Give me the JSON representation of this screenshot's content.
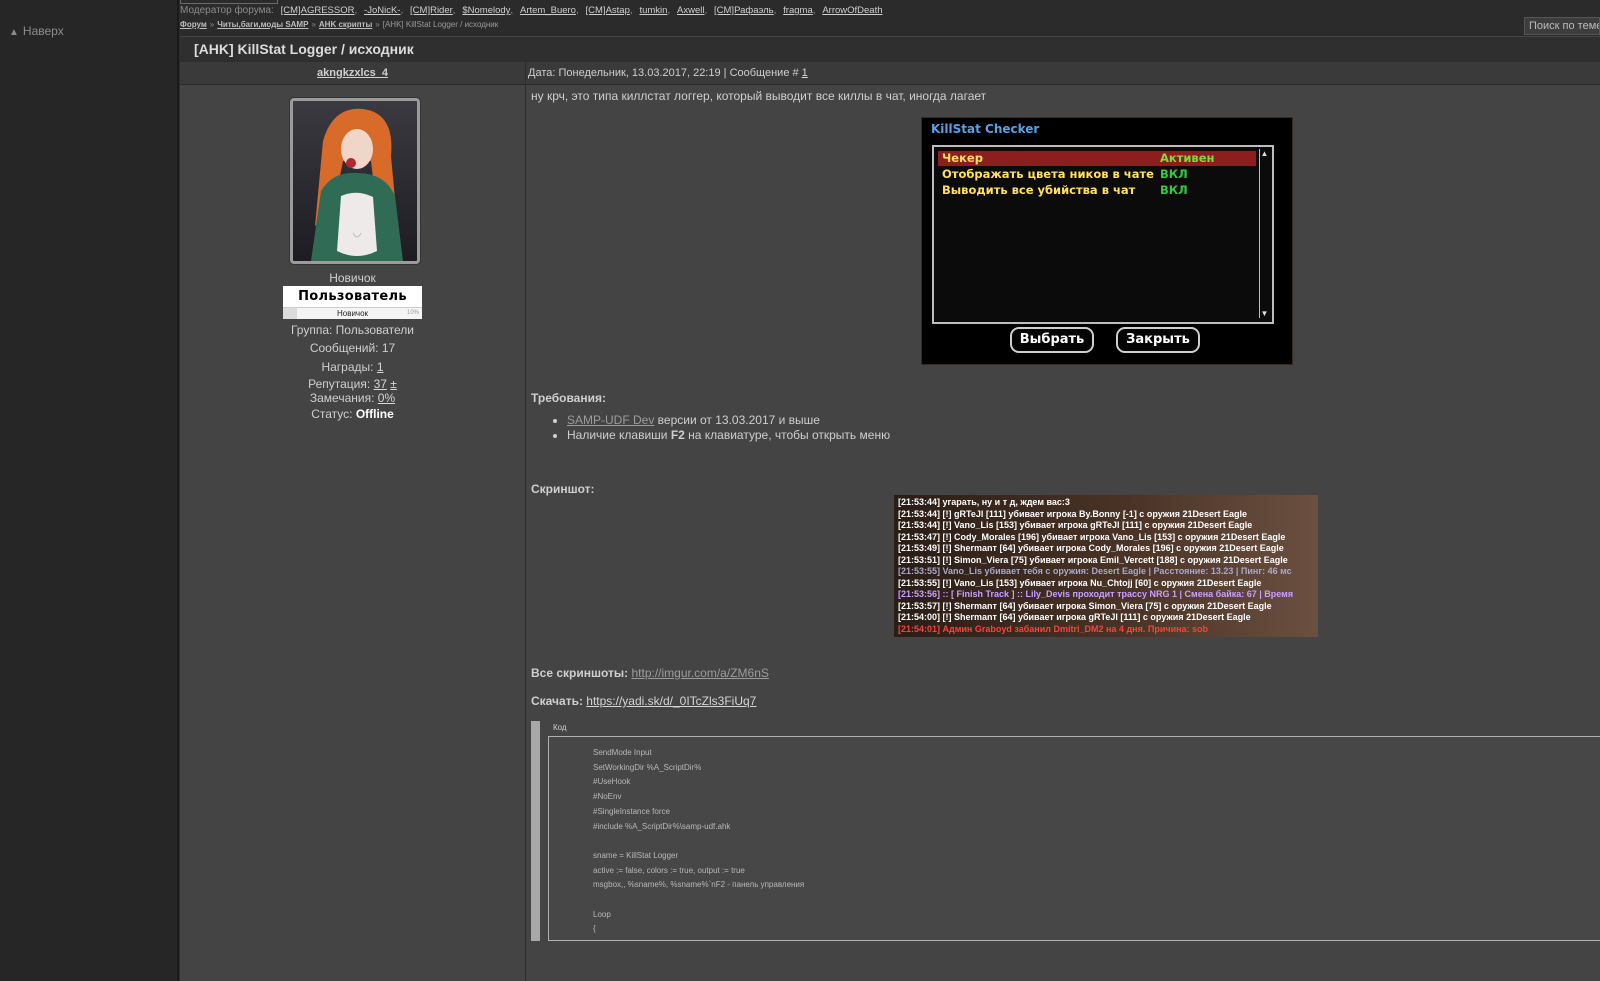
{
  "sidebar": {
    "to_top": "Наверх"
  },
  "topbar": {
    "moderators_label": "Модератор форума:",
    "moderators": [
      "[CM]AGRESSOR",
      "-JoNicK-",
      "[CM]Rider",
      "$Nomelody",
      "Artem_Buero",
      "[CM]Astap",
      "tumkin",
      "Axwell",
      "[CM]Рафаэль",
      "fragma",
      "ArrowOfDeath"
    ],
    "breadcrumb": [
      "Форум",
      "Читы,баги,моды SAMP",
      "AHK скрипты"
    ],
    "breadcrumb_current": "[AHK] KillStat Logger / исходник",
    "search_label": "Поиск по теме"
  },
  "thread": {
    "title": "[AHK] KillStat Logger / исходник"
  },
  "post": {
    "author": "akngkzxlcs_4",
    "date_text": "Дата: Понедельник, 13.03.2017, 22:19 | Сообщение #",
    "post_number": "1",
    "intro": "ну крч, это типа киллстат логгер, который выводит все киллы в чат, иногда лагает",
    "requirements_label": "Требования:",
    "requirements": {
      "item1_link": "SAMP-UDF Dev",
      "item1_rest": " версии от 13.03.2017 и выше",
      "item2_a": "Наличие клавиши ",
      "item2_key": "F2",
      "item2_b": " на клавиатуре, чтобы открыть меню"
    },
    "screenshot_label": "Скриншот:",
    "all_screens_label": "Все скриншоты:",
    "all_screens_link": "http://imgur.com/a/ZM6nS",
    "download_label": "Скачать:",
    "download_link": "https://yadi.sk/d/_0ITcZls3FiUq7",
    "code_label": "Код",
    "code_lines": [
      "SendMode Input",
      "SetWorkingDir %A_ScriptDir%",
      "#UseHook",
      "#NoEnv",
      "#SingleInstance force",
      "#include %A_ScriptDir%\\samp-udf.ahk",
      "",
      "sname = KillStat Logger",
      "active := false, colors := true, output := true",
      "msgbox,, %sname%, %sname%`nF2 - панель управления",
      "",
      "Loop",
      "{"
    ]
  },
  "user": {
    "rank": "Новичок",
    "rank_badge": "Пользователь",
    "rank_bar_label": "Новичок",
    "rank_bar_percent": "10%",
    "rank_progress": 0.1,
    "group": "Группа: Пользователи",
    "messages": "Сообщений: 17",
    "awards_label": "Награды:",
    "awards_value": "1",
    "reputation_label": "Репутация:",
    "reputation_value": "37",
    "reputation_plus": "±",
    "warnings_label": "Замечания:",
    "warnings_value": "0%",
    "status_label": "Статус:",
    "status_value": "Offline"
  },
  "killstat_dialog": {
    "title": "KillStat Checker",
    "rows": [
      {
        "name": "Чекер",
        "value": "Активен",
        "name_color": "#ffe060",
        "value_color": "#7ddc3a"
      },
      {
        "name": "Отображать цвета ников в чате",
        "value": "ВКЛ",
        "name_color": "#ffe060",
        "value_color": "#36c840"
      },
      {
        "name": "Выводить все убийства в чат",
        "value": "ВКЛ",
        "name_color": "#ffe060",
        "value_color": "#36c840"
      }
    ],
    "select_button": "Выбрать",
    "close_button": "Закрыть"
  },
  "chat_log": [
    {
      "time": "[21:53:44]",
      "text": " угарать, ну и т д, ждем вас:3"
    },
    {
      "time": "[21:53:44]",
      "text": " [!] gRTeJl [111] убивает игрока By.Bonny [-1] с оружия 21Desert Eagle"
    },
    {
      "time": "[21:53:44]",
      "text": " [!] Vano_Lis [153] убивает игрока gRTeJl [111] с оружия 21Desert Eagle"
    },
    {
      "time": "[21:53:47]",
      "text": " [!] Cody_Morales [196] убивает игрока Vano_Lis [153] с оружия 21Desert Eagle"
    },
    {
      "time": "[21:53:49]",
      "text": " [!] Shermanт [64] убивает игрока Cody_Morales [196] с оружия 21Desert Eagle"
    },
    {
      "time": "[21:53:51]",
      "text": " [!] Simon_Viera [75] убивает игрока Emil_Vercett [188] с оружия 21Desert Eagle"
    },
    {
      "time": "[21:53:55]",
      "text": " Vano_Lis убивает тебя с оружия: Desert Eagle | Расстояние: 13.23 | Пинг: 46 мс"
    },
    {
      "time": "[21:53:55]",
      "text": " [!] Vano_Lis [153] убивает игрока Nu_Chtojj [60] с оружия 21Desert Eagle"
    },
    {
      "time": "[21:53:56]",
      "text": " :: [ Finish Track ] :: Lily_Devis проходит трассу NRG 1 | Смена байка: 67 | Время"
    },
    {
      "time": "[21:53:57]",
      "text": " [!] Shermanт [64] убивает игрока Simon_Viera [75] с оружия 21Desert Eagle"
    },
    {
      "time": "[21:54:00]",
      "text": " [!] Shermanт [64] убивает игрока gRTeJl [111] с оружия 21Desert Eagle"
    },
    {
      "time": "[21:54:01]",
      "text": " Админ Graboyd забанил Dmitri_DM2 на 4 дня. Причина: sob"
    }
  ],
  "colors": {
    "chat_default": "#ffffff",
    "chat_gray": "#a9a9c9",
    "chat_violet": "#c9a0ff",
    "chat_red": "#ff4040"
  }
}
